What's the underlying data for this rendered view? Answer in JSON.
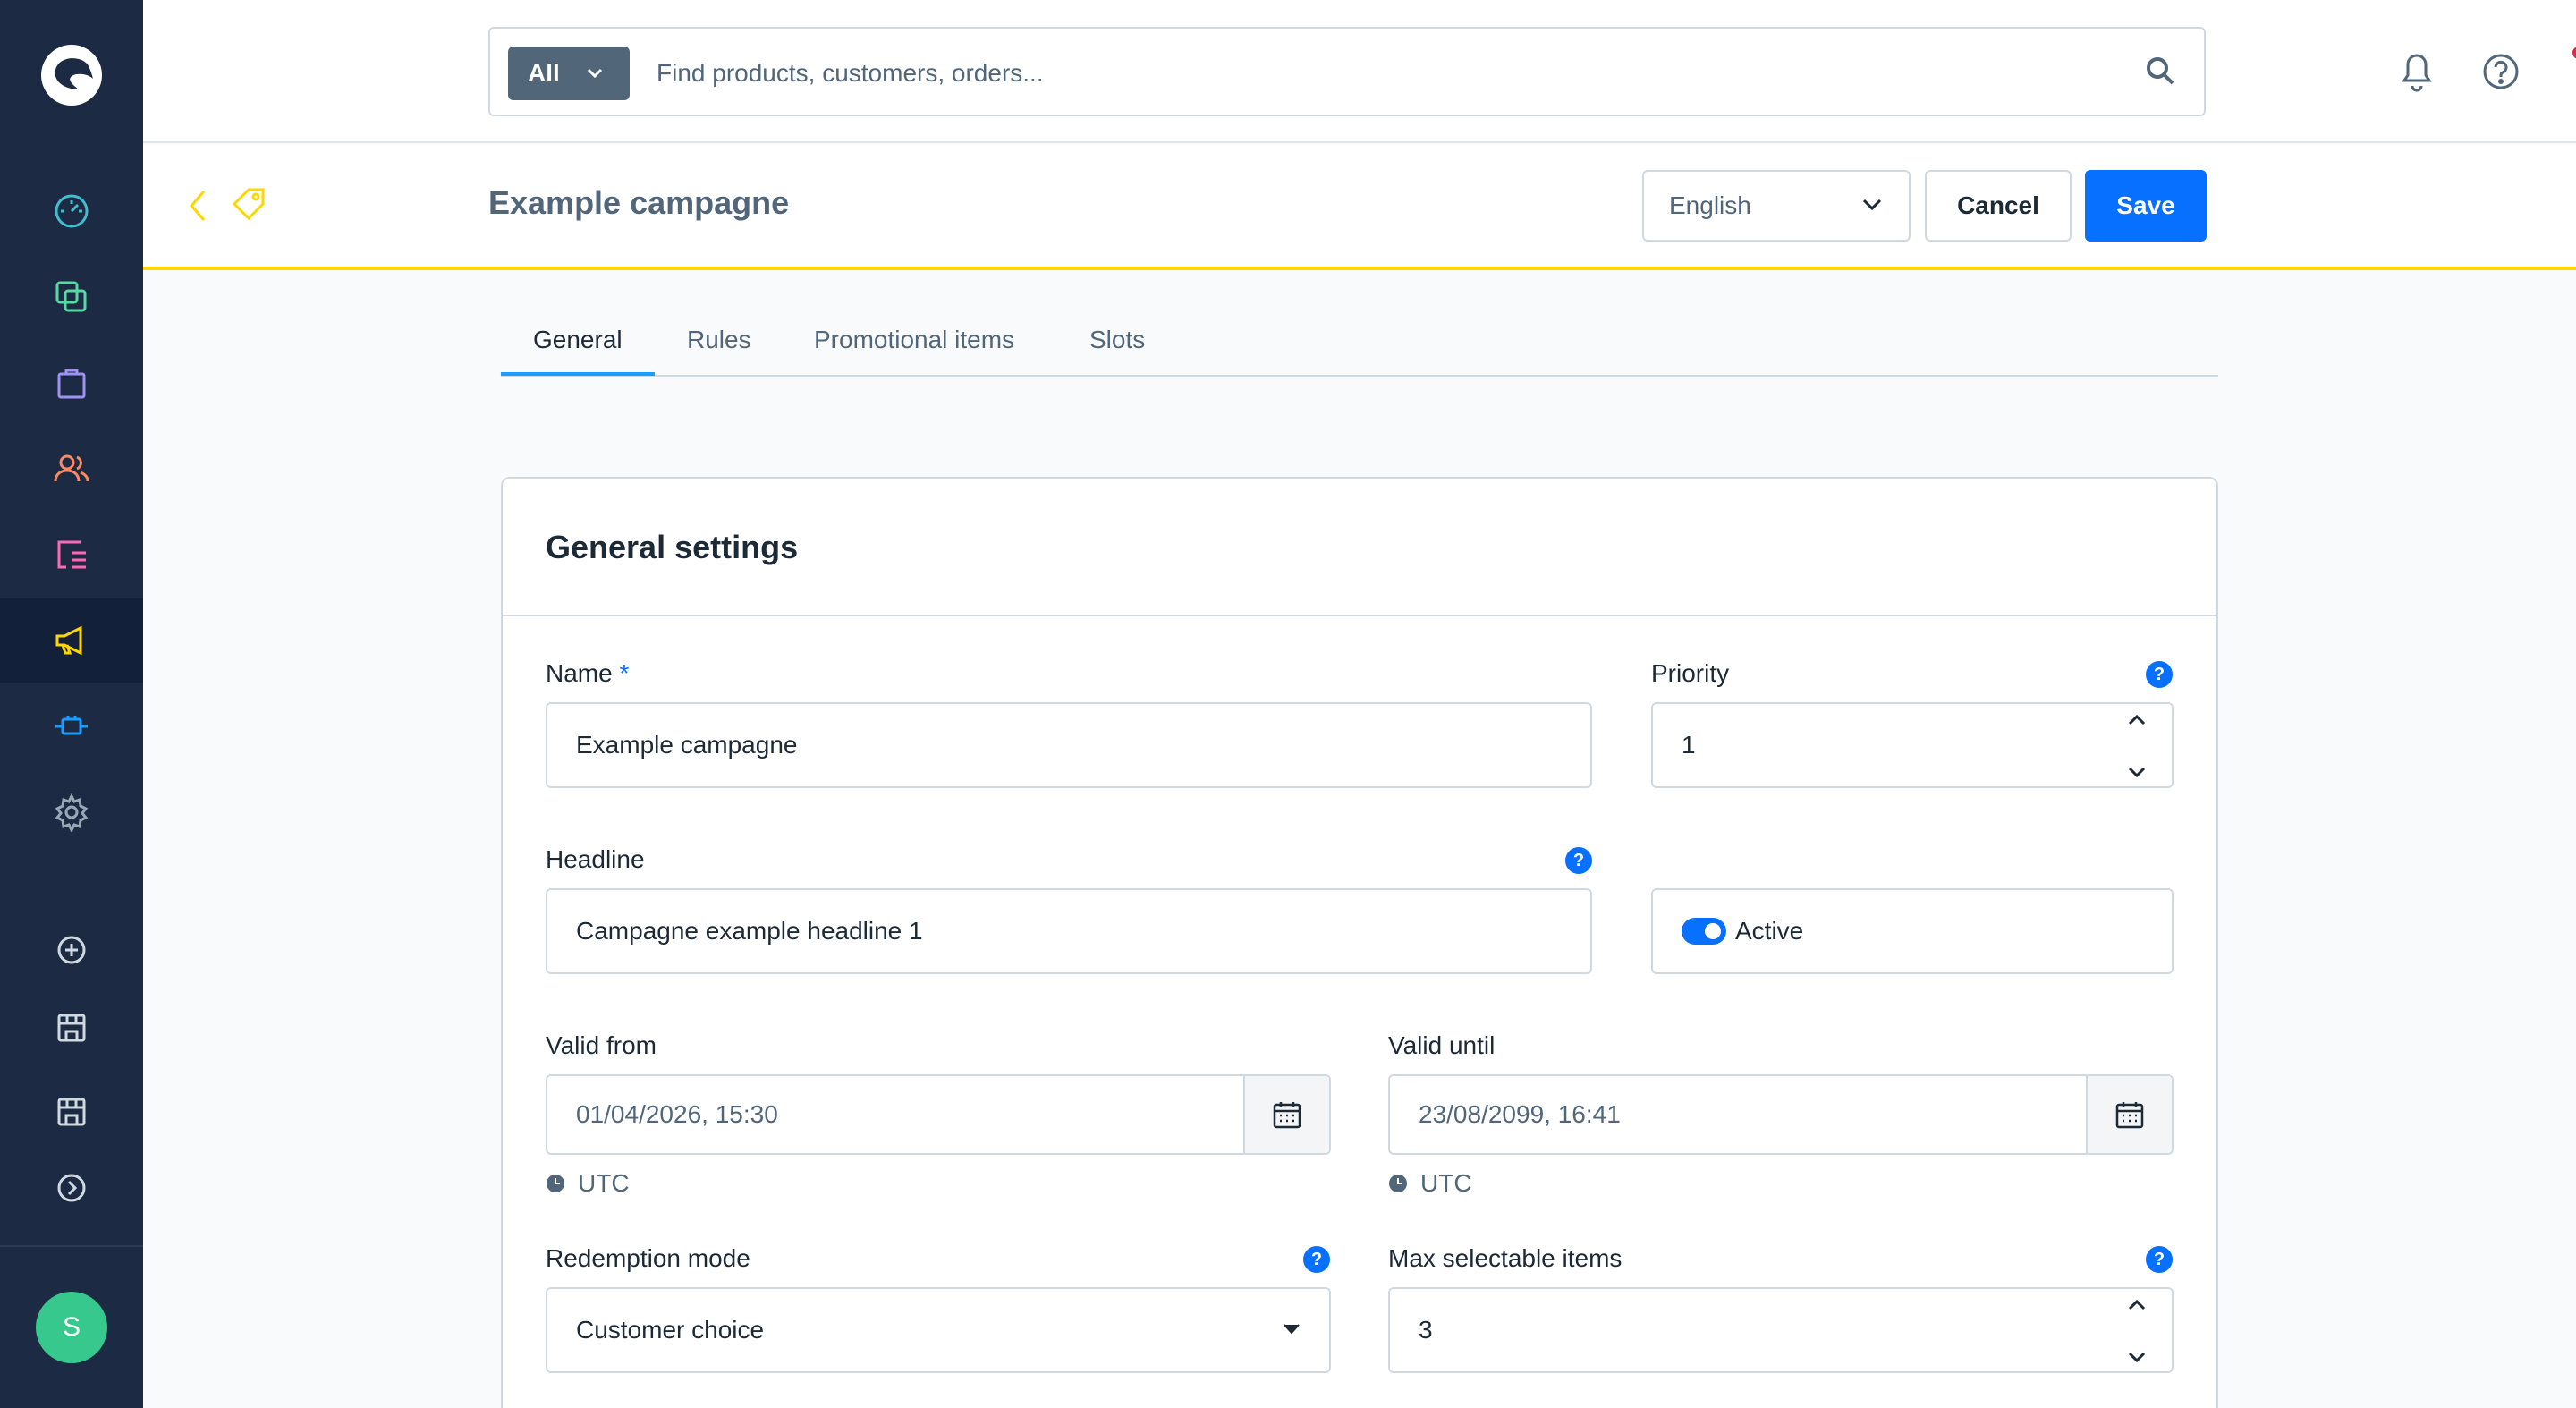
{
  "sidebar": {
    "logo": "shopware-logo",
    "items": [
      {
        "icon": "dashboard-icon",
        "color": "#3ebecf"
      },
      {
        "icon": "catalog-icon",
        "color": "#57d9a3"
      },
      {
        "icon": "orders-icon",
        "color": "#a092f0"
      },
      {
        "icon": "customers-icon",
        "color": "#f88962"
      },
      {
        "icon": "content-icon",
        "color": "#ff68b4"
      },
      {
        "icon": "marketing-icon",
        "color": "#ffd700",
        "active": true
      },
      {
        "icon": "extensions-icon",
        "color": "#189eff"
      },
      {
        "icon": "settings-icon",
        "color": "#9aa8b5"
      },
      {
        "icon": "add-sales-channel-icon",
        "color": "#d1d9e0"
      },
      {
        "icon": "storefront-icon",
        "color": "#d1d9e0"
      },
      {
        "icon": "storefront-icon",
        "color": "#d1d9e0"
      },
      {
        "icon": "expand-icon",
        "color": "#d1d9e0"
      }
    ],
    "avatar_initial": "S",
    "avatar_color": "#37c88e"
  },
  "search": {
    "type_label": "All",
    "placeholder": "Find products, customers, orders..."
  },
  "header": {
    "title": "Example campagne",
    "language": "English",
    "cancel_label": "Cancel",
    "save_label": "Save",
    "accent_color": "#ffd700"
  },
  "tabs": [
    {
      "label": "General",
      "active": true
    },
    {
      "label": "Rules"
    },
    {
      "label": "Promotional items"
    },
    {
      "label": "Slots"
    }
  ],
  "card": {
    "title": "General settings",
    "name": {
      "label": "Name",
      "required_mark": "*",
      "value": "Example campagne"
    },
    "priority": {
      "label": "Priority",
      "value": "1"
    },
    "headline": {
      "label": "Headline",
      "value": "Campagne example headline 1"
    },
    "active": {
      "label": "Active",
      "checked": true
    },
    "valid_from": {
      "label": "Valid from",
      "value": "01/04/2026, 15:30",
      "timezone": "UTC"
    },
    "valid_until": {
      "label": "Valid until",
      "value": "23/08/2099, 16:41",
      "timezone": "UTC"
    },
    "redemption_mode": {
      "label": "Redemption mode",
      "value": "Customer choice"
    },
    "max_selectable": {
      "label": "Max selectable items",
      "value": "3"
    },
    "help_mark": "?"
  }
}
